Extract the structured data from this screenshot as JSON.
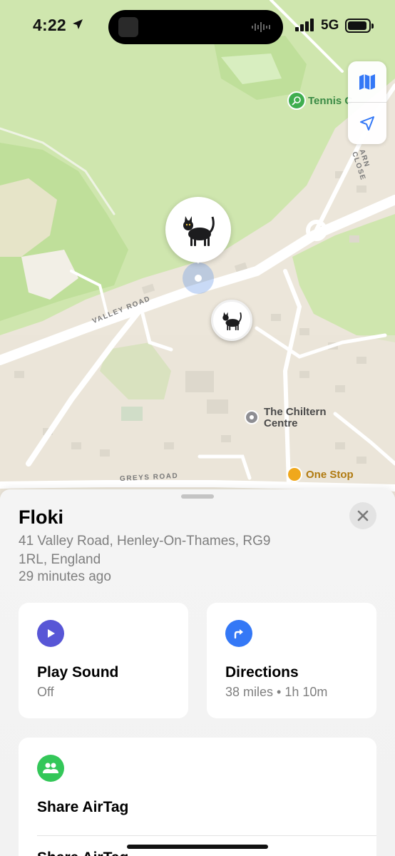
{
  "status": {
    "time": "4:22",
    "network": "5G"
  },
  "map": {
    "poi": {
      "tennis": "Tennis C",
      "chiltern": "The Chiltern Centre",
      "one_stop": "One Stop"
    },
    "roads": {
      "valley": "VALLEY ROAD",
      "greys": "GREYS ROAD",
      "close": "ARN CLOSE"
    },
    "pin_emoji": "🐈‍⬛"
  },
  "item": {
    "name": "Floki",
    "address": "41 Valley Road, Henley-On-Thames, RG9 1RL, England",
    "last_seen": "29 minutes ago"
  },
  "actions": {
    "play_sound": {
      "title": "Play Sound",
      "subtitle": "Off",
      "color": "#5856d6"
    },
    "directions": {
      "title": "Directions",
      "subtitle": "38 miles • 1h 10m",
      "color": "#3478f6"
    },
    "share": {
      "title": "Share AirTag",
      "color": "#34c759"
    },
    "next_row": "Share AirTag"
  },
  "colors": {
    "accent": "#3478f6",
    "park": "#c9e6a8",
    "water": "#b8d6f0"
  }
}
